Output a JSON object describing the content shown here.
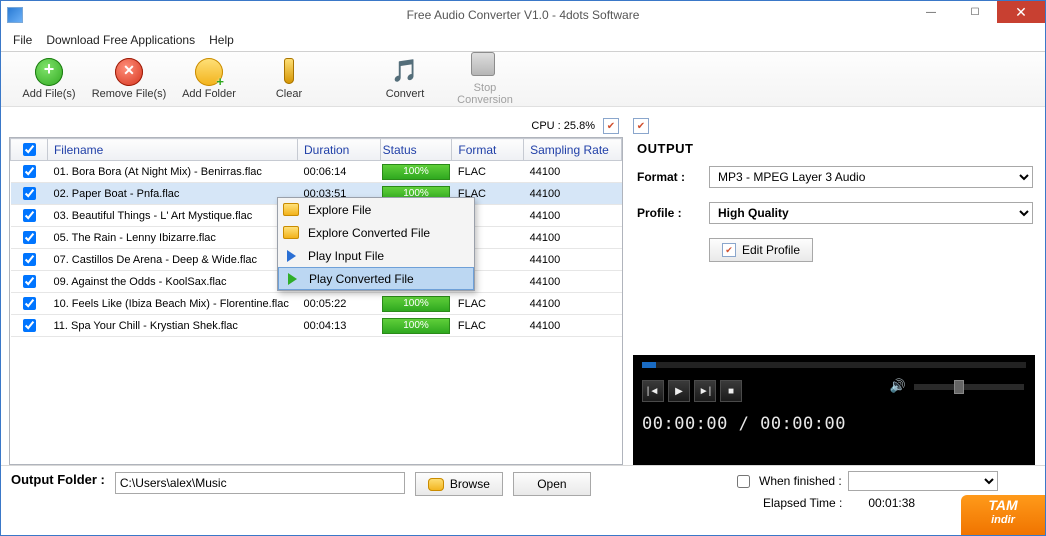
{
  "title": "Free Audio Converter V1.0 - 4dots Software",
  "menu": {
    "file": "File",
    "download": "Download Free Applications",
    "help": "Help"
  },
  "tools": {
    "add": "Add File(s)",
    "remove": "Remove File(s)",
    "addfolder": "Add Folder",
    "clear": "Clear",
    "convert": "Convert",
    "stop": "Stop Conversion"
  },
  "cpu": {
    "label": "CPU : 25.8%"
  },
  "columns": {
    "filename": "Filename",
    "duration": "Duration",
    "status": "Status",
    "format": "Format",
    "sampling": "Sampling Rate"
  },
  "rows": [
    {
      "file": "01. Bora Bora (At Night Mix) - Benirras.flac",
      "dur": "00:06:14",
      "stat": "100%",
      "fmt": "FLAC",
      "sr": "44100"
    },
    {
      "file": "02. Paper Boat - Pnfa.flac",
      "dur": "00:03:51",
      "stat": "100%",
      "fmt": "FLAC",
      "sr": "44100"
    },
    {
      "file": "03. Beautiful Things - L' Art Mystique.flac",
      "dur": "",
      "stat": "",
      "fmt": "",
      "sr": "44100"
    },
    {
      "file": "05. The Rain - Lenny Ibizarre.flac",
      "dur": "",
      "stat": "",
      "fmt": "",
      "sr": "44100"
    },
    {
      "file": "07. Castillos De Arena - Deep & Wide.flac",
      "dur": "",
      "stat": "",
      "fmt": "",
      "sr": "44100"
    },
    {
      "file": "09. Against the Odds - KoolSax.flac",
      "dur": "",
      "stat": "",
      "fmt": "",
      "sr": "44100"
    },
    {
      "file": "10. Feels Like (Ibiza Beach Mix) - Florentine.flac",
      "dur": "00:05:22",
      "stat": "100%",
      "fmt": "FLAC",
      "sr": "44100"
    },
    {
      "file": "11. Spa Your Chill - Krystian Shek.flac",
      "dur": "00:04:13",
      "stat": "100%",
      "fmt": "FLAC",
      "sr": "44100"
    }
  ],
  "selected_row": 1,
  "context": {
    "explore": "Explore File",
    "explore_conv": "Explore Converted File",
    "play_in": "Play Input File",
    "play_conv": "Play Converted File"
  },
  "output": {
    "heading": "OUTPUT",
    "format_lbl": "Format :",
    "format_val": "MP3 - MPEG Layer 3 Audio",
    "profile_lbl": "Profile :",
    "profile_val": "High Quality",
    "edit_profile": "Edit Profile"
  },
  "player": {
    "time": "00:00:00 / 00:00:00"
  },
  "footer": {
    "outlbl": "Output Folder :",
    "path": "C:\\Users\\alex\\Music",
    "browse": "Browse",
    "open": "Open",
    "when": "When finished :",
    "elapsed_lbl": "Elapsed Time :",
    "elapsed": "00:01:38"
  },
  "brand": {
    "top": "TAM",
    "bot": "indir"
  }
}
